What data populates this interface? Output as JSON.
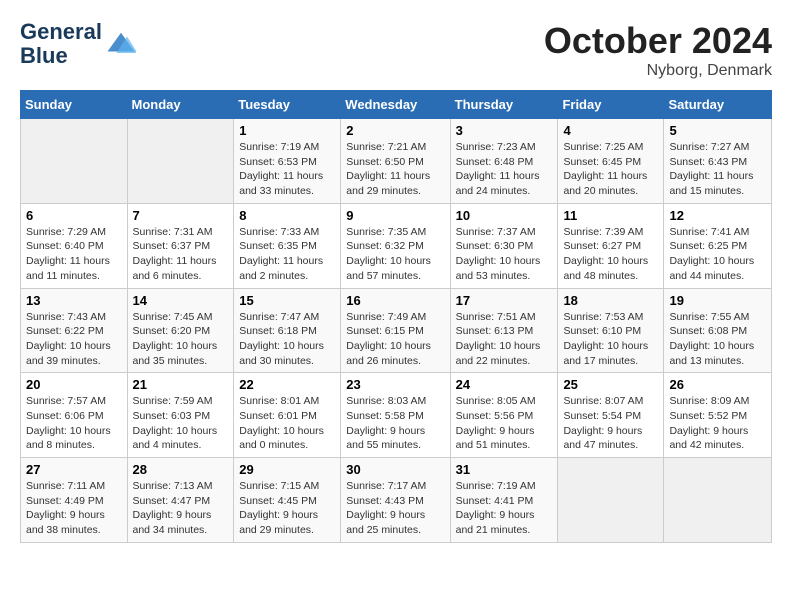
{
  "logo": {
    "line1": "General",
    "line2": "Blue"
  },
  "title": "October 2024",
  "location": "Nyborg, Denmark",
  "days_of_week": [
    "Sunday",
    "Monday",
    "Tuesday",
    "Wednesday",
    "Thursday",
    "Friday",
    "Saturday"
  ],
  "weeks": [
    [
      {
        "day": "",
        "info": ""
      },
      {
        "day": "",
        "info": ""
      },
      {
        "day": "1",
        "info": "Sunrise: 7:19 AM\nSunset: 6:53 PM\nDaylight: 11 hours\nand 33 minutes."
      },
      {
        "day": "2",
        "info": "Sunrise: 7:21 AM\nSunset: 6:50 PM\nDaylight: 11 hours\nand 29 minutes."
      },
      {
        "day": "3",
        "info": "Sunrise: 7:23 AM\nSunset: 6:48 PM\nDaylight: 11 hours\nand 24 minutes."
      },
      {
        "day": "4",
        "info": "Sunrise: 7:25 AM\nSunset: 6:45 PM\nDaylight: 11 hours\nand 20 minutes."
      },
      {
        "day": "5",
        "info": "Sunrise: 7:27 AM\nSunset: 6:43 PM\nDaylight: 11 hours\nand 15 minutes."
      }
    ],
    [
      {
        "day": "6",
        "info": "Sunrise: 7:29 AM\nSunset: 6:40 PM\nDaylight: 11 hours\nand 11 minutes."
      },
      {
        "day": "7",
        "info": "Sunrise: 7:31 AM\nSunset: 6:37 PM\nDaylight: 11 hours\nand 6 minutes."
      },
      {
        "day": "8",
        "info": "Sunrise: 7:33 AM\nSunset: 6:35 PM\nDaylight: 11 hours\nand 2 minutes."
      },
      {
        "day": "9",
        "info": "Sunrise: 7:35 AM\nSunset: 6:32 PM\nDaylight: 10 hours\nand 57 minutes."
      },
      {
        "day": "10",
        "info": "Sunrise: 7:37 AM\nSunset: 6:30 PM\nDaylight: 10 hours\nand 53 minutes."
      },
      {
        "day": "11",
        "info": "Sunrise: 7:39 AM\nSunset: 6:27 PM\nDaylight: 10 hours\nand 48 minutes."
      },
      {
        "day": "12",
        "info": "Sunrise: 7:41 AM\nSunset: 6:25 PM\nDaylight: 10 hours\nand 44 minutes."
      }
    ],
    [
      {
        "day": "13",
        "info": "Sunrise: 7:43 AM\nSunset: 6:22 PM\nDaylight: 10 hours\nand 39 minutes."
      },
      {
        "day": "14",
        "info": "Sunrise: 7:45 AM\nSunset: 6:20 PM\nDaylight: 10 hours\nand 35 minutes."
      },
      {
        "day": "15",
        "info": "Sunrise: 7:47 AM\nSunset: 6:18 PM\nDaylight: 10 hours\nand 30 minutes."
      },
      {
        "day": "16",
        "info": "Sunrise: 7:49 AM\nSunset: 6:15 PM\nDaylight: 10 hours\nand 26 minutes."
      },
      {
        "day": "17",
        "info": "Sunrise: 7:51 AM\nSunset: 6:13 PM\nDaylight: 10 hours\nand 22 minutes."
      },
      {
        "day": "18",
        "info": "Sunrise: 7:53 AM\nSunset: 6:10 PM\nDaylight: 10 hours\nand 17 minutes."
      },
      {
        "day": "19",
        "info": "Sunrise: 7:55 AM\nSunset: 6:08 PM\nDaylight: 10 hours\nand 13 minutes."
      }
    ],
    [
      {
        "day": "20",
        "info": "Sunrise: 7:57 AM\nSunset: 6:06 PM\nDaylight: 10 hours\nand 8 minutes."
      },
      {
        "day": "21",
        "info": "Sunrise: 7:59 AM\nSunset: 6:03 PM\nDaylight: 10 hours\nand 4 minutes."
      },
      {
        "day": "22",
        "info": "Sunrise: 8:01 AM\nSunset: 6:01 PM\nDaylight: 10 hours\nand 0 minutes."
      },
      {
        "day": "23",
        "info": "Sunrise: 8:03 AM\nSunset: 5:58 PM\nDaylight: 9 hours\nand 55 minutes."
      },
      {
        "day": "24",
        "info": "Sunrise: 8:05 AM\nSunset: 5:56 PM\nDaylight: 9 hours\nand 51 minutes."
      },
      {
        "day": "25",
        "info": "Sunrise: 8:07 AM\nSunset: 5:54 PM\nDaylight: 9 hours\nand 47 minutes."
      },
      {
        "day": "26",
        "info": "Sunrise: 8:09 AM\nSunset: 5:52 PM\nDaylight: 9 hours\nand 42 minutes."
      }
    ],
    [
      {
        "day": "27",
        "info": "Sunrise: 7:11 AM\nSunset: 4:49 PM\nDaylight: 9 hours\nand 38 minutes."
      },
      {
        "day": "28",
        "info": "Sunrise: 7:13 AM\nSunset: 4:47 PM\nDaylight: 9 hours\nand 34 minutes."
      },
      {
        "day": "29",
        "info": "Sunrise: 7:15 AM\nSunset: 4:45 PM\nDaylight: 9 hours\nand 29 minutes."
      },
      {
        "day": "30",
        "info": "Sunrise: 7:17 AM\nSunset: 4:43 PM\nDaylight: 9 hours\nand 25 minutes."
      },
      {
        "day": "31",
        "info": "Sunrise: 7:19 AM\nSunset: 4:41 PM\nDaylight: 9 hours\nand 21 minutes."
      },
      {
        "day": "",
        "info": ""
      },
      {
        "day": "",
        "info": ""
      }
    ]
  ]
}
